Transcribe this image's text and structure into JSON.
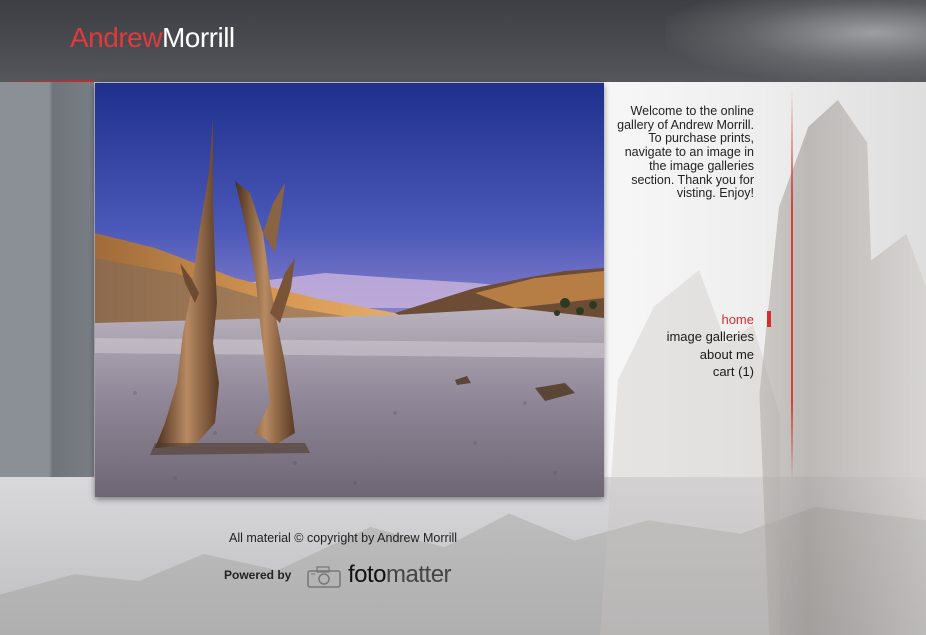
{
  "header": {
    "logo_first": "Andrew",
    "logo_last": "Morrill"
  },
  "welcome_text": "Welcome to the online gallery of Andrew Morrill. To purchase prints, navigate to an image in the image galleries section. Thank you for visting. Enjoy!",
  "nav": {
    "items": [
      {
        "label": "home",
        "active": true
      },
      {
        "label": "image galleries",
        "active": false
      },
      {
        "label": "about me",
        "active": false
      },
      {
        "label": "cart (1)",
        "active": false
      }
    ]
  },
  "footer": {
    "copyright": "All material © copyright by Andrew Morrill",
    "powered_by": "Powered by",
    "brand_foto": "foto",
    "brand_matter": "matter"
  },
  "colors": {
    "accent": "#d32f2f",
    "header_bg": "#45474c",
    "logo_first": "#e03a3a"
  },
  "photo": {
    "subject": "bristlecone-snag-landscape"
  }
}
